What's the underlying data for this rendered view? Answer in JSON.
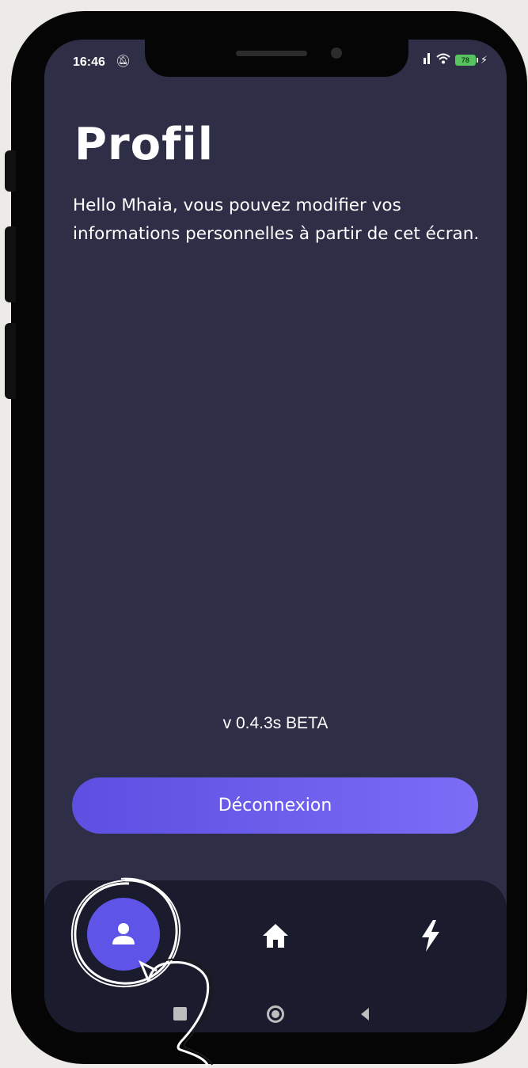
{
  "status_bar": {
    "time": "16:46",
    "left_icons": [
      "bell-off-icon",
      "notification-icon"
    ],
    "right_icons": [
      "signal-icon",
      "wifi-icon",
      "battery-icon",
      "charging-icon"
    ],
    "battery": "78"
  },
  "header": {
    "title": "Profil",
    "intro": "Hello Mhaia, vous pouvez modifier vos informations personnelles à partir de cet écran."
  },
  "footer": {
    "version": "v 0.4.3s BETA",
    "logout_label": "Déconnexion"
  },
  "bottom_nav": {
    "items": [
      {
        "icon": "user-icon",
        "active": true
      },
      {
        "icon": "home-icon",
        "active": false
      },
      {
        "icon": "lightning-icon",
        "active": false
      }
    ]
  },
  "colors": {
    "screen_bg": "#2e2e47",
    "nav_bg": "#1b1b2e",
    "accent": "#5f54e8",
    "button_gradient_start": "#5d4fe0",
    "button_gradient_end": "#7c6df7"
  }
}
